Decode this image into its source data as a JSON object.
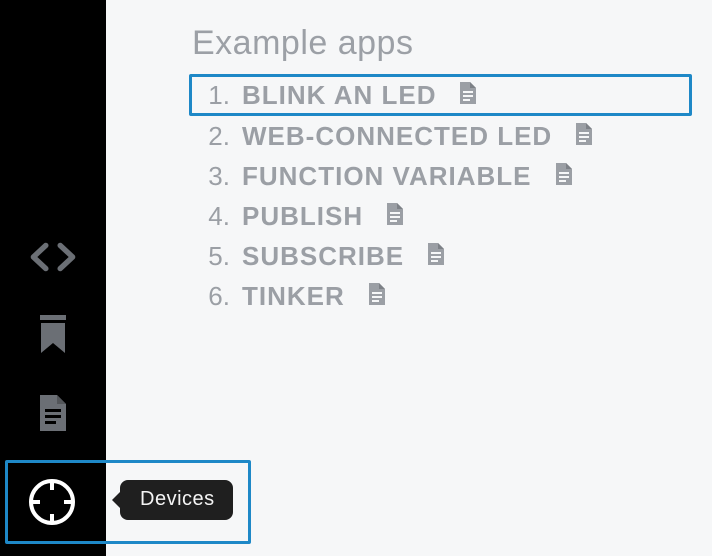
{
  "sidebar": {
    "icons": {
      "code": "code-icon",
      "bookmark": "bookmark-icon",
      "doc": "document-icon",
      "target": "target-icon"
    },
    "tooltip": "Devices"
  },
  "main": {
    "title": "Example apps",
    "apps": [
      {
        "label": "BLINK AN LED",
        "highlighted": true
      },
      {
        "label": "WEB-CONNECTED LED",
        "highlighted": false
      },
      {
        "label": "FUNCTION VARIABLE",
        "highlighted": false
      },
      {
        "label": "PUBLISH",
        "highlighted": false
      },
      {
        "label": "SUBSCRIBE",
        "highlighted": false
      },
      {
        "label": "TINKER",
        "highlighted": false
      }
    ]
  }
}
